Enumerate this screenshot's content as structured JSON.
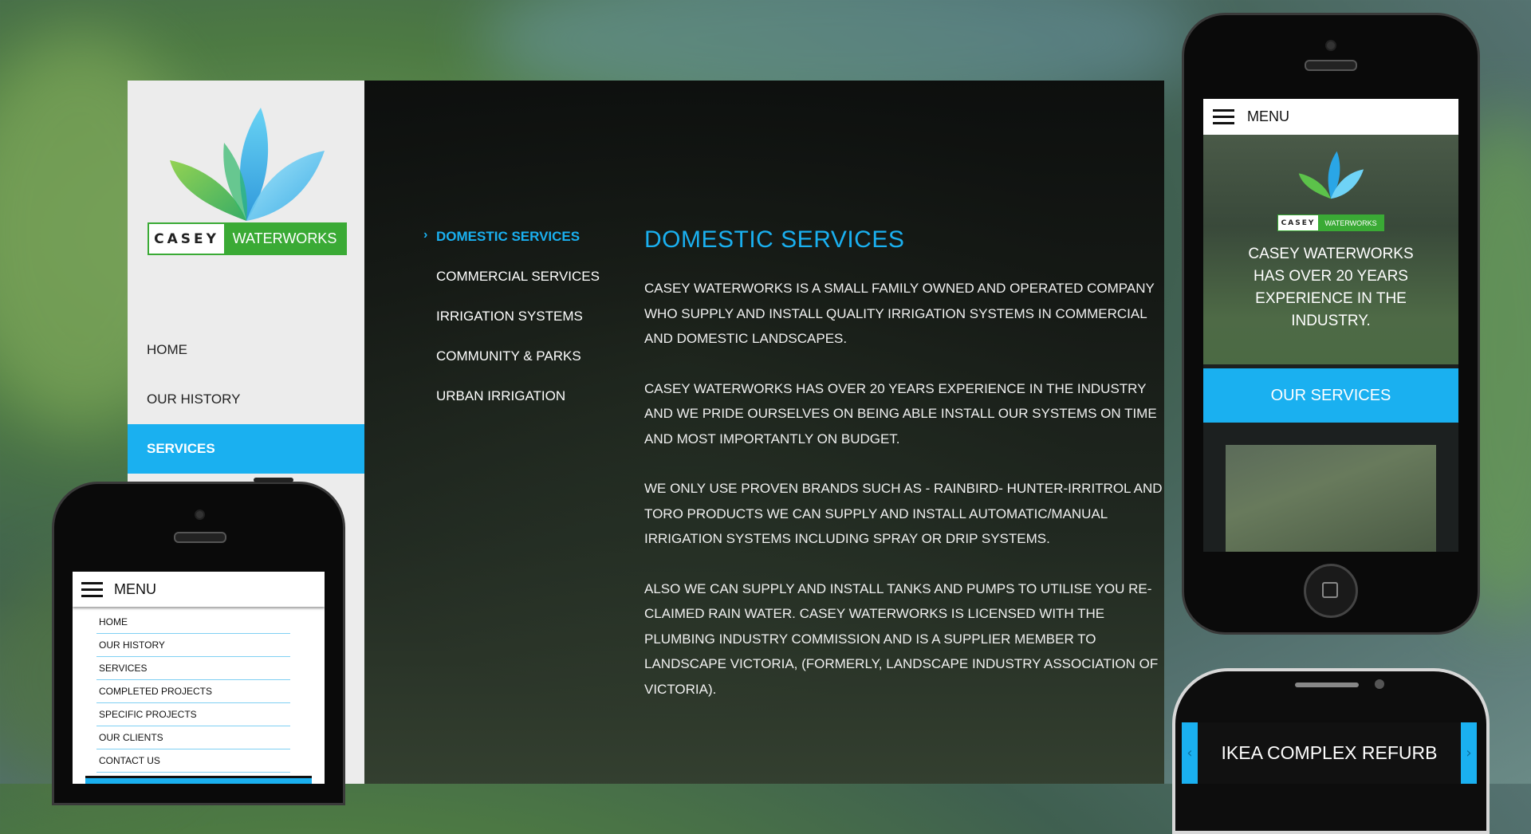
{
  "brand": {
    "name_left": "CASEY",
    "name_right": "WATERWORKS"
  },
  "sidebar": {
    "items": [
      {
        "label": "HOME"
      },
      {
        "label": "OUR HISTORY"
      },
      {
        "label": "SERVICES"
      }
    ]
  },
  "subnav": {
    "items": [
      {
        "label": "DOMESTIC SERVICES"
      },
      {
        "label": "COMMERCIAL SERVICES"
      },
      {
        "label": "IRRIGATION SYSTEMS"
      },
      {
        "label": "COMMUNITY & PARKS"
      },
      {
        "label": "URBAN IRRIGATION"
      }
    ]
  },
  "content": {
    "title": "DOMESTIC SERVICES",
    "paragraphs": [
      "CASEY WATERWORKS IS A SMALL FAMILY OWNED AND OPERATED COMPANY WHO SUPPLY AND INSTALL QUALITY IRRIGATION SYSTEMS IN COMMERCIAL AND DOMESTIC LANDSCAPES.",
      "CASEY WATERWORKS HAS OVER 20 YEARS EXPERIENCE IN THE INDUSTRY AND WE PRIDE OURSELVES ON BEING ABLE INSTALL OUR SYSTEMS ON TIME AND MOST IMPORTANTLY ON BUDGET.",
      "WE ONLY USE PROVEN BRANDS SUCH AS - RAINBIRD- HUNTER-IRRITROL AND TORO PRODUCTS WE CAN SUPPLY AND INSTALL AUTOMATIC/MANUAL IRRIGATION SYSTEMS INCLUDING SPRAY OR DRIP SYSTEMS.",
      "ALSO WE CAN SUPPLY AND INSTALL TANKS AND PUMPS TO UTILISE YOU RE-CLAIMED RAIN WATER. CASEY WATERWORKS IS LICENSED WITH THE PLUMBING INDUSTRY COMMISSION AND IS A SUPPLIER MEMBER TO LANDSCAPE VICTORIA, (FORMERLY, LANDSCAPE INDUSTRY ASSOCIATION OF VICTORIA)."
    ]
  },
  "mobile_small": {
    "menu_label": "MENU",
    "items": [
      {
        "label": "HOME"
      },
      {
        "label": "OUR HISTORY"
      },
      {
        "label": "SERVICES"
      },
      {
        "label": "COMPLETED PROJECTS"
      },
      {
        "label": "SPECIFIC PROJECTS"
      },
      {
        "label": "OUR CLIENTS"
      },
      {
        "label": "CONTACT US"
      }
    ]
  },
  "mobile_tall": {
    "menu_label": "MENU",
    "tagline": "CASEY WATERWORKS HAS OVER 20 YEARS EXPERIENCE IN THE INDUSTRY.",
    "services_button": "OUR SERVICES"
  },
  "mobile_android": {
    "slide_title": "IKEA COMPLEX REFURB"
  },
  "colors": {
    "accent_blue": "#1ab0f0",
    "brand_green": "#3aaa35",
    "sidebar_bg": "#ececec"
  },
  "icons": [
    "leaf-logo-icon",
    "chevron-right-icon",
    "hamburger-icon",
    "camera-icon",
    "home-button-icon",
    "arrow-left-icon",
    "arrow-right-icon"
  ]
}
